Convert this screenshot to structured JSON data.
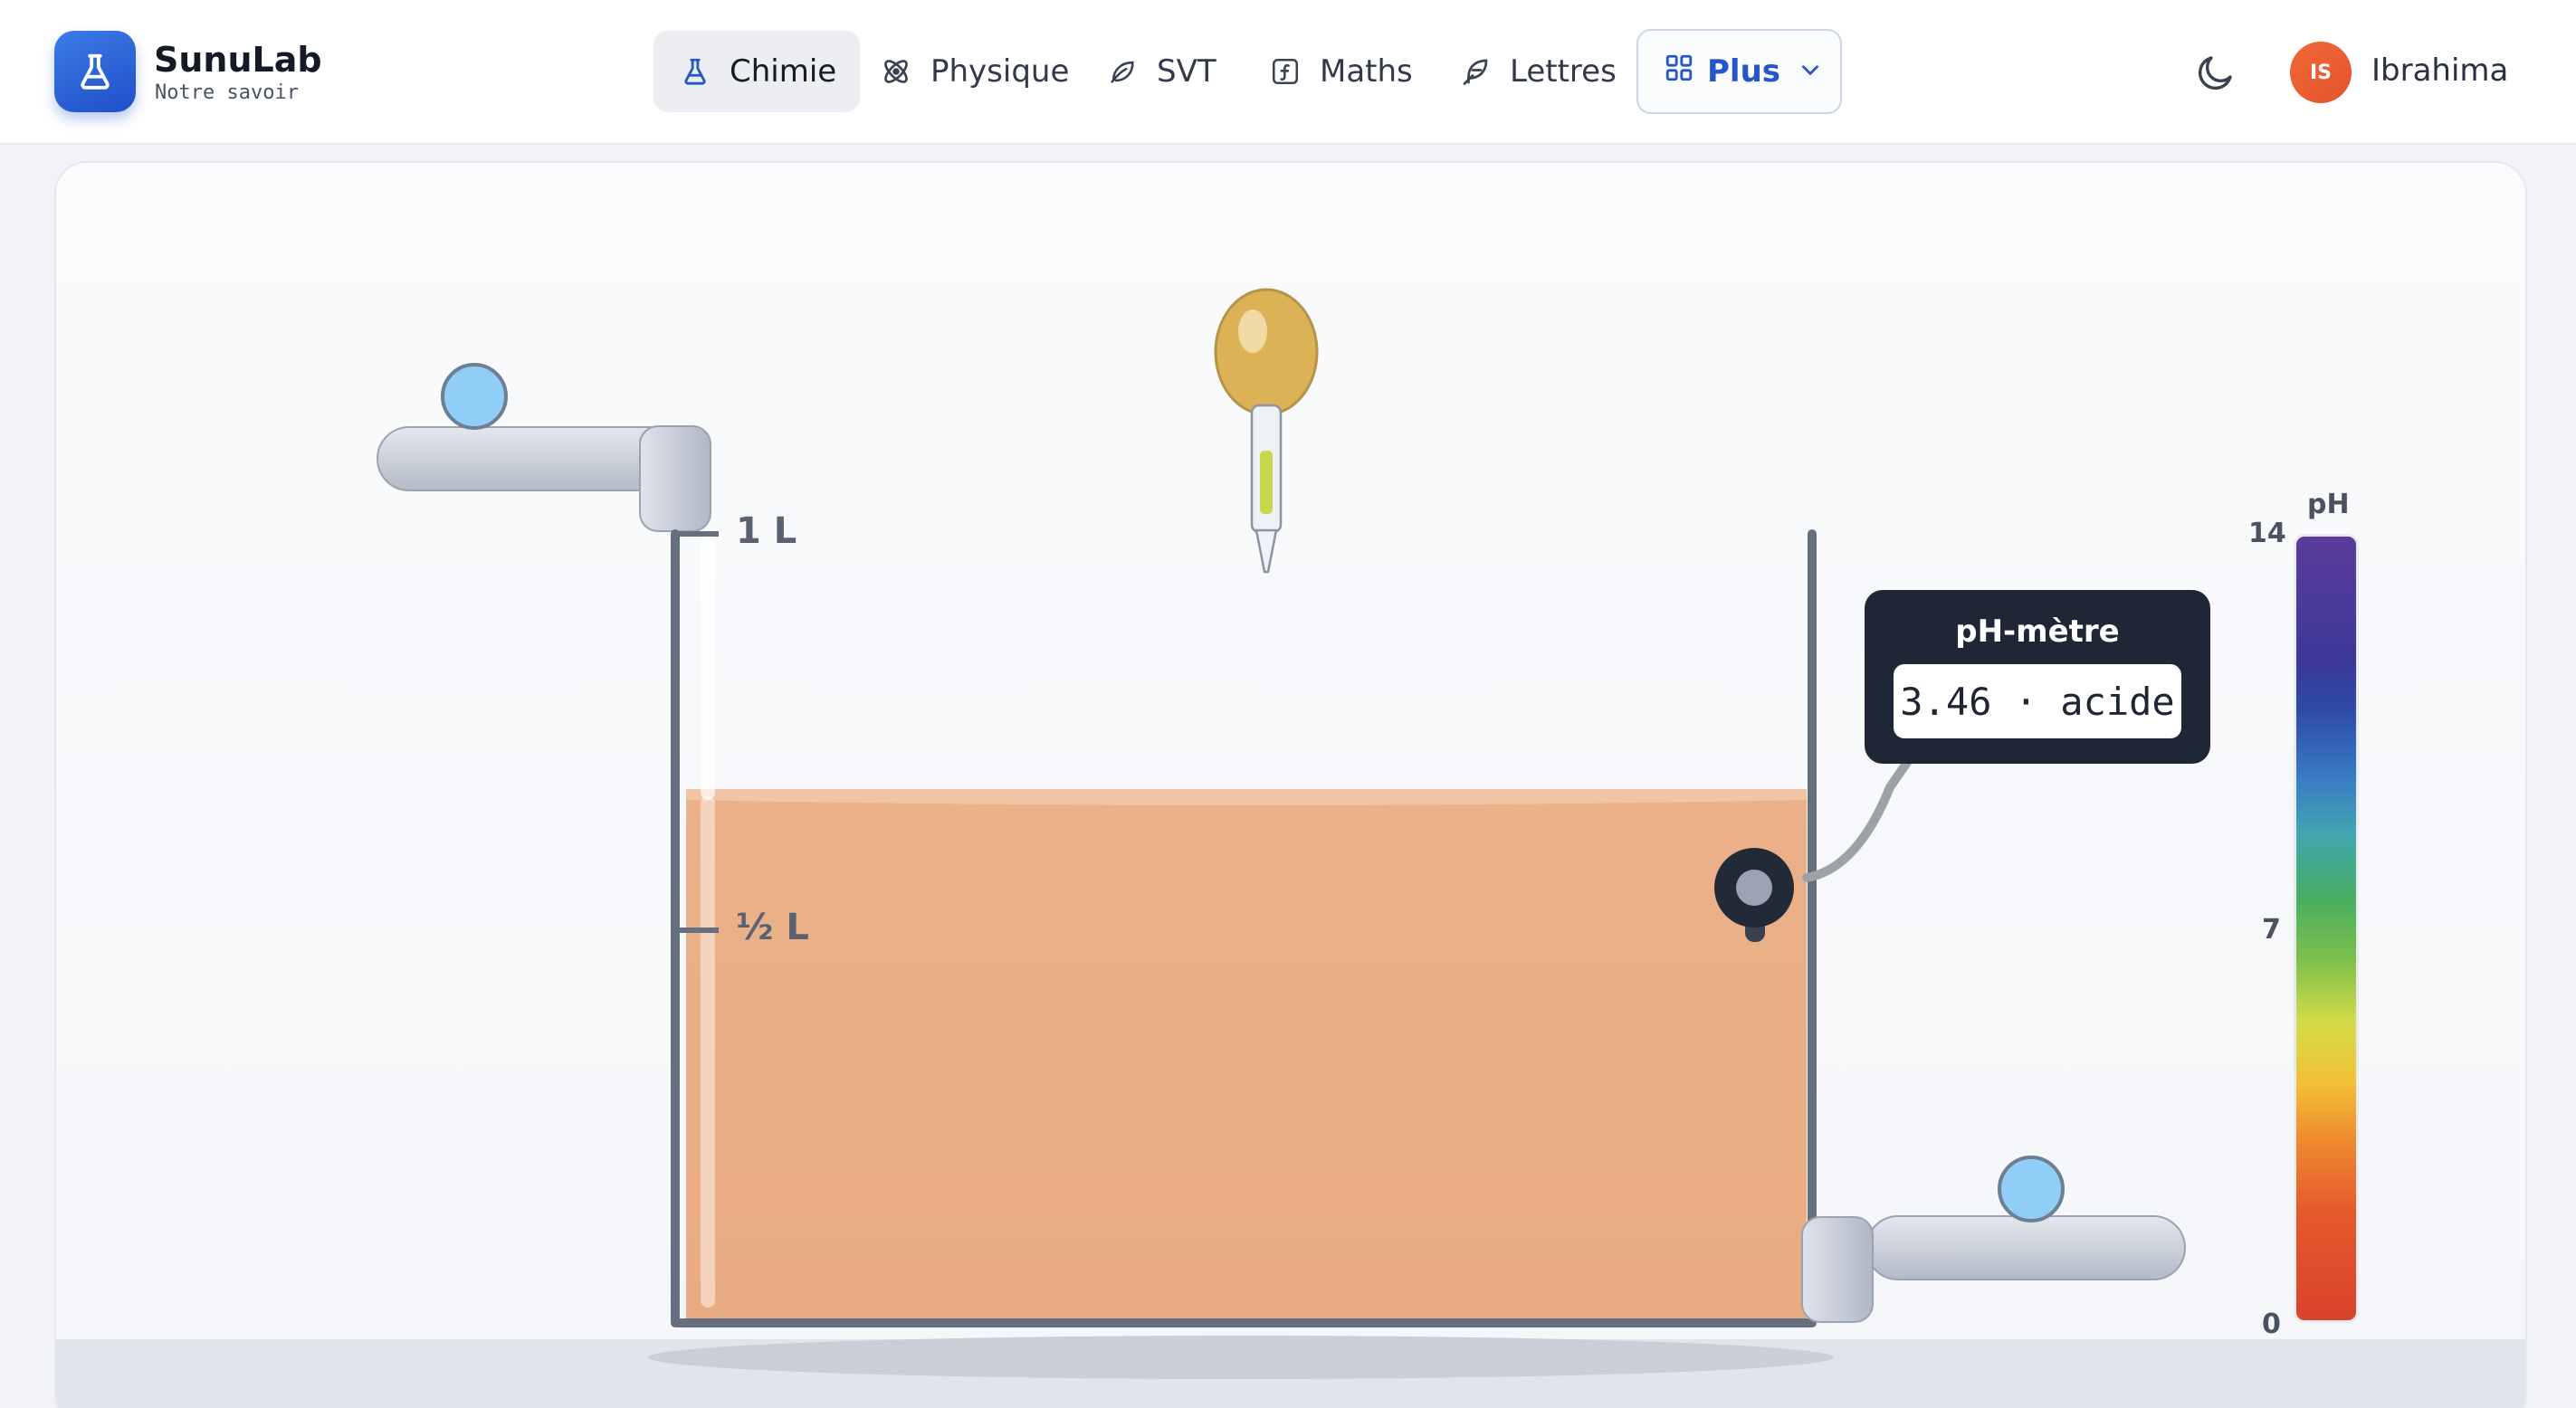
{
  "header": {
    "brand_name": "SunuLab",
    "brand_tagline": "Notre savoir",
    "nav": [
      {
        "label": "Chimie",
        "icon": "flask-icon",
        "active": true
      },
      {
        "label": "Physique",
        "icon": "atom-icon",
        "active": false
      },
      {
        "label": "SVT",
        "icon": "leaf-icon",
        "active": false
      },
      {
        "label": "Maths",
        "icon": "function-icon",
        "active": false
      },
      {
        "label": "Lettres",
        "icon": "feather-icon",
        "active": false
      }
    ],
    "more_label": "Plus",
    "theme_icon": "moon-icon",
    "user_initials": "IS",
    "user_name": "Ibrahima"
  },
  "simulation": {
    "tank_marks": {
      "full": "1 L",
      "half": "½ L"
    },
    "liquid_level_fraction": 0.67,
    "liquid_color": "#e9af86",
    "ph_meter": {
      "title": "pH-mètre",
      "reading": "3.46 · acide",
      "value": 3.46,
      "state": "acide"
    },
    "ph_scale": {
      "title": "pH",
      "labels": [
        "14",
        "7",
        "0"
      ],
      "min": 0,
      "max": 14
    },
    "valve_color": "#90cdf7",
    "dropper_bulb_color": "#dbb255"
  },
  "colors": {
    "accent": "#2456c8",
    "avatar": "#ea5f32",
    "ph_meter_bg": "#1f2737"
  }
}
